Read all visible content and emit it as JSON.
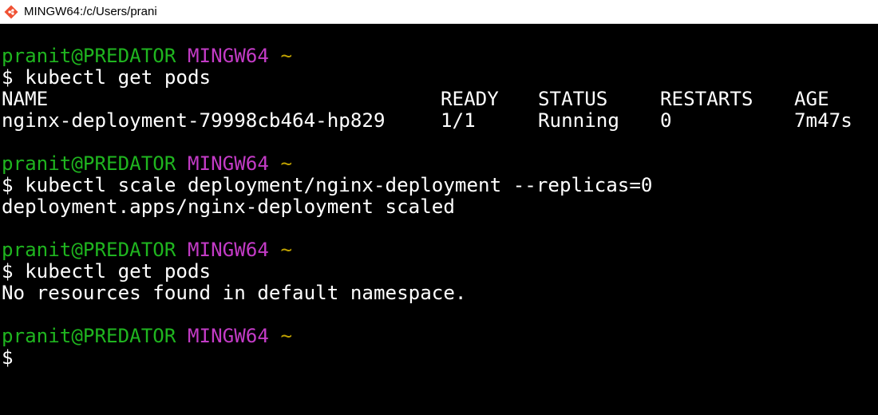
{
  "window": {
    "title": "MINGW64:/c/Users/prani",
    "icon": "git-bash-icon"
  },
  "colors": {
    "user_host": "#1fb51f",
    "shell_name": "#c33bc6",
    "cwd": "#c1a300",
    "text": "#ffffff",
    "background": "#000000"
  },
  "prompt": {
    "user_host": "pranit@PREDATOR",
    "shell": "MINGW64",
    "cwd": "~",
    "symbol": "$"
  },
  "blocks": [
    {
      "command": "kubectl get pods",
      "table": {
        "headers": [
          "NAME",
          "READY",
          "STATUS",
          "RESTARTS",
          "AGE"
        ],
        "rows": [
          [
            "nginx-deployment-79998cb464-hp829",
            "1/1",
            "Running",
            "0",
            "7m47s"
          ]
        ]
      }
    },
    {
      "command": "kubectl scale deployment/nginx-deployment --replicas=0",
      "output": "deployment.apps/nginx-deployment scaled"
    },
    {
      "command": "kubectl get pods",
      "output": "No resources found in default namespace."
    },
    {
      "command": ""
    }
  ]
}
